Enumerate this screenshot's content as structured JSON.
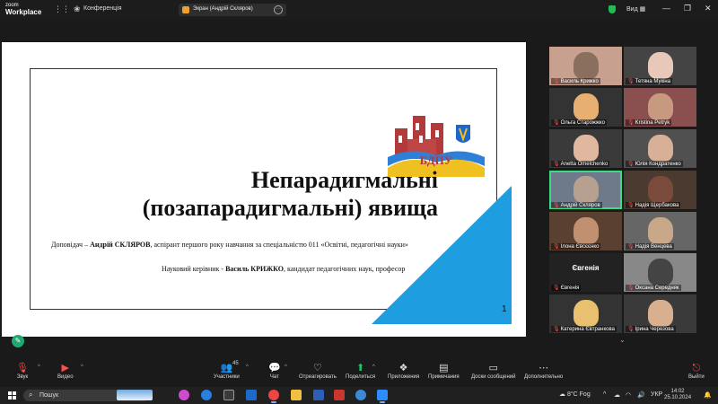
{
  "titlebar": {
    "logo_top": "zoom",
    "logo_bottom": "Workplace",
    "conference_label": "Конференція",
    "share_label": "Экран (Андрій Скляров)",
    "view_label": "Вид"
  },
  "slide": {
    "title_line1": "Непарадигмальні",
    "title_line2": "(позапарадигмальні) явища",
    "speaker_prefix": "Доповідач – ",
    "speaker_name": "Андрій СКЛЯРОВ",
    "speaker_suffix": ", аспірант першого року навчання за спеціальністю 011 «Освітні, педагогічні науки»",
    "advisor_prefix": "Науковий керівник - ",
    "advisor_name": "Василь КРИЖКО",
    "advisor_suffix": ", кандидат педагогічних наук, професор",
    "page_number": "1",
    "logo_text": "БДПУ"
  },
  "participants": [
    {
      "name": "Василь Крижко",
      "muted": true,
      "face": "#8a6e5e",
      "bg": "#c8a090"
    },
    {
      "name": "Тетяна Мукіна",
      "muted": true,
      "face": "#e8c8b8",
      "bg": "#444"
    },
    {
      "name": "Ольга Старожжко",
      "muted": true,
      "face": "#e8b070",
      "bg": "#333"
    },
    {
      "name": "Kristina Petryk",
      "muted": true,
      "face": "#c79a80",
      "bg": "#8a5050"
    },
    {
      "name": "Anetta Omelchenko",
      "muted": true,
      "face": "#e0b8a0",
      "bg": "#3a3a3a"
    },
    {
      "name": "Юлія Кондратенко",
      "muted": true,
      "face": "#d8b098",
      "bg": "#505050"
    },
    {
      "name": "Андрій Скляров",
      "muted": true,
      "face": "#b8a090",
      "bg": "#6e7a8a",
      "active": true
    },
    {
      "name": "Надія Щербакова",
      "muted": true,
      "face": "#7a4a3a",
      "bg": "#4a3a30"
    },
    {
      "name": "Ілона Євсєєнко",
      "muted": true,
      "face": "#c09070",
      "bg": "#5a4030"
    },
    {
      "name": "Надія Венцева",
      "muted": true,
      "face": "#c8a888",
      "bg": "#666"
    },
    {
      "name": "Євгенія",
      "muted": true,
      "big": "Євгенія",
      "bg": "#222"
    },
    {
      "name": "Оксана Середняк",
      "muted": true,
      "face": "#444",
      "bg": "#888"
    },
    {
      "name": "Катерина Євтранкова",
      "muted": true,
      "face": "#e8c070",
      "bg": "#333"
    },
    {
      "name": "Ірина Черезова",
      "muted": true,
      "face": "#d8b090",
      "bg": "#3a3a3a"
    }
  ],
  "toolbar": {
    "sound": "Звук",
    "video": "Видео",
    "participants": "Участники",
    "participants_count": "45",
    "chat": "Чат",
    "react": "Отреагировать",
    "share": "Поделиться",
    "apps": "Приложения",
    "notes": "Примечания",
    "whiteboard": "Доски сообщений",
    "more": "Дополнительно",
    "leave": "Выйти"
  },
  "taskbar": {
    "search_placeholder": "Пошук",
    "weather": "8°C  Fog",
    "lang": "УКР",
    "time": "14:02",
    "date": "25.10.2024"
  },
  "icons": {
    "grid": "grid-icon",
    "shield": "shield-icon",
    "mic_off": "mic-off-icon",
    "camera_off": "camera-off-icon"
  },
  "colors": {
    "accent_green": "#1fc36b",
    "mute_red": "#ff4d4d",
    "slide_blue": "#1e9ee0"
  }
}
